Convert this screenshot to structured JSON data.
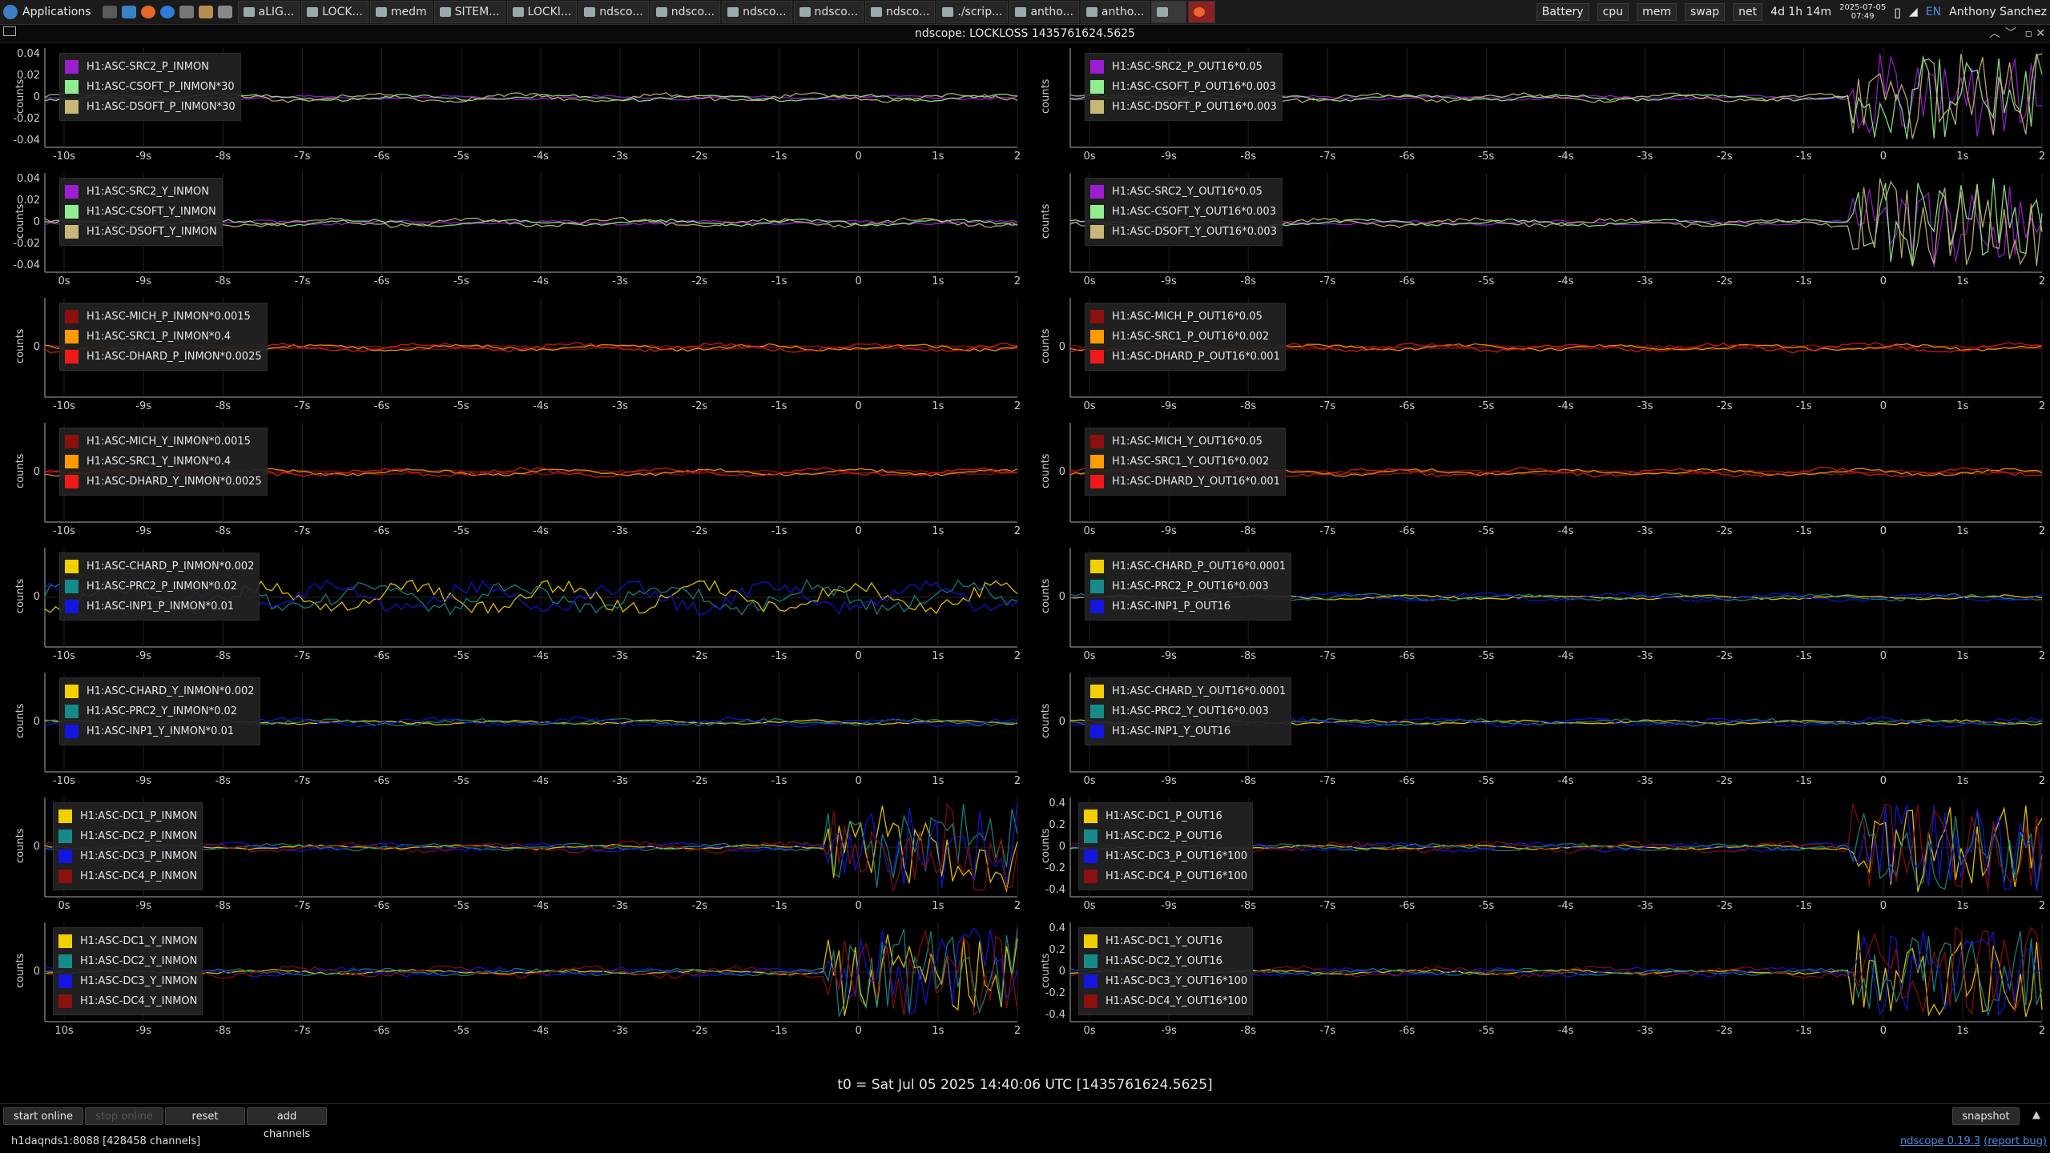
{
  "taskbar": {
    "applications_label": "Applications",
    "tasks": [
      {
        "label": "aLIG...",
        "active": false
      },
      {
        "label": "LOCK...",
        "active": false
      },
      {
        "label": "medm",
        "active": false
      },
      {
        "label": "SITEM...",
        "active": false
      },
      {
        "label": "LOCKI...",
        "active": false
      },
      {
        "label": "ndsco...",
        "active": false
      },
      {
        "label": "ndsco...",
        "active": false
      },
      {
        "label": "ndsco...",
        "active": false
      },
      {
        "label": "ndsco...",
        "active": false
      },
      {
        "label": "ndsco...",
        "active": false
      },
      {
        "label": "./scrip...",
        "active": false
      },
      {
        "label": "antho...",
        "active": false
      },
      {
        "label": "antho...",
        "active": false
      }
    ],
    "monitors": [
      "Battery",
      "cpu",
      "mem",
      "swap",
      "net"
    ],
    "uptime": "4d 1h 14m",
    "date": "2025-07-05",
    "time": "07:49",
    "lang": "EN",
    "user": "Anthony Sanchez"
  },
  "window": {
    "title": "ndscope: LOCKLOSS 1435761624.5625"
  },
  "y_axis_label": "counts",
  "panels": [
    {
      "legend": [
        {
          "label": "H1:ASC-SRC2_P_INMON",
          "color": "#9b1fd0"
        },
        {
          "label": "H1:ASC-CSOFT_P_INMON*30",
          "color": "#90ee90"
        },
        {
          "label": "H1:ASC-DSOFT_P_INMON*30",
          "color": "#c8b878"
        }
      ],
      "yticks": [
        "0.04",
        "0.02",
        "0",
        "-0.02",
        "-0.04"
      ],
      "xticks": [
        "-10s",
        "-9s",
        "-8s",
        "-7s",
        "-6s",
        "-5s",
        "-4s",
        "-3s",
        "-2s",
        "-1s",
        "0",
        "1s",
        "2"
      ]
    },
    {
      "legend": [
        {
          "label": "H1:ASC-SRC2_P_OUT16*0.05",
          "color": "#9b1fd0"
        },
        {
          "label": "H1:ASC-CSOFT_P_OUT16*0.003",
          "color": "#90ee90"
        },
        {
          "label": "H1:ASC-DSOFT_P_OUT16*0.003",
          "color": "#c8b878"
        }
      ],
      "yticks": [],
      "xticks": [
        "0s",
        "-9s",
        "-8s",
        "-7s",
        "-6s",
        "-5s",
        "-4s",
        "-3s",
        "-2s",
        "-1s",
        "0",
        "1s",
        "2"
      ]
    },
    {
      "legend": [
        {
          "label": "H1:ASC-SRC2_Y_INMON",
          "color": "#9b1fd0"
        },
        {
          "label": "H1:ASC-CSOFT_Y_INMON",
          "color": "#90ee90"
        },
        {
          "label": "H1:ASC-DSOFT_Y_INMON",
          "color": "#c8b878"
        }
      ],
      "yticks": [
        "0.04",
        "0.02",
        "0",
        "-0.02",
        "-0.04"
      ],
      "xticks": [
        "0s",
        "-9s",
        "-8s",
        "-7s",
        "-6s",
        "-5s",
        "-4s",
        "-3s",
        "-2s",
        "-1s",
        "0",
        "1s",
        "2"
      ]
    },
    {
      "legend": [
        {
          "label": "H1:ASC-SRC2_Y_OUT16*0.05",
          "color": "#9b1fd0"
        },
        {
          "label": "H1:ASC-CSOFT_Y_OUT16*0.003",
          "color": "#90ee90"
        },
        {
          "label": "H1:ASC-DSOFT_Y_OUT16*0.003",
          "color": "#c8b878"
        }
      ],
      "yticks": [],
      "xticks": [
        "0s",
        "-9s",
        "-8s",
        "-7s",
        "-6s",
        "-5s",
        "-4s",
        "-3s",
        "-2s",
        "-1s",
        "0",
        "1s",
        "2"
      ]
    },
    {
      "legend": [
        {
          "label": "H1:ASC-MICH_P_INMON*0.0015",
          "color": "#8b1010"
        },
        {
          "label": "H1:ASC-SRC1_P_INMON*0.4",
          "color": "#ff9a00"
        },
        {
          "label": "H1:ASC-DHARD_P_INMON*0.0025",
          "color": "#ee1a1a"
        }
      ],
      "yticks": [
        "0"
      ],
      "xticks": [
        "-10s",
        "-9s",
        "-8s",
        "-7s",
        "-6s",
        "-5s",
        "-4s",
        "-3s",
        "-2s",
        "-1s",
        "0",
        "1s",
        "2"
      ]
    },
    {
      "legend": [
        {
          "label": "H1:ASC-MICH_P_OUT16*0.05",
          "color": "#8b1010"
        },
        {
          "label": "H1:ASC-SRC1_P_OUT16*0.002",
          "color": "#ff9a00"
        },
        {
          "label": "H1:ASC-DHARD_P_OUT16*0.001",
          "color": "#ee1a1a"
        }
      ],
      "yticks": [
        "0"
      ],
      "xticks": [
        "0s",
        "-9s",
        "-8s",
        "-7s",
        "-6s",
        "-5s",
        "-4s",
        "-3s",
        "-2s",
        "-1s",
        "0",
        "1s",
        "2"
      ]
    },
    {
      "legend": [
        {
          "label": "H1:ASC-MICH_Y_INMON*0.0015",
          "color": "#8b1010"
        },
        {
          "label": "H1:ASC-SRC1_Y_INMON*0.4",
          "color": "#ff9a00"
        },
        {
          "label": "H1:ASC-DHARD_Y_INMON*0.0025",
          "color": "#ee1a1a"
        }
      ],
      "yticks": [
        "0"
      ],
      "xticks": [
        "-10s",
        "-9s",
        "-8s",
        "-7s",
        "-6s",
        "-5s",
        "-4s",
        "-3s",
        "-2s",
        "-1s",
        "0",
        "1s",
        "2"
      ]
    },
    {
      "legend": [
        {
          "label": "H1:ASC-MICH_Y_OUT16*0.05",
          "color": "#8b1010"
        },
        {
          "label": "H1:ASC-SRC1_Y_OUT16*0.002",
          "color": "#ff9a00"
        },
        {
          "label": "H1:ASC-DHARD_Y_OUT16*0.001",
          "color": "#ee1a1a"
        }
      ],
      "yticks": [
        "0"
      ],
      "xticks": [
        "0s",
        "-9s",
        "-8s",
        "-7s",
        "-6s",
        "-5s",
        "-4s",
        "-3s",
        "-2s",
        "-1s",
        "0",
        "1s",
        "2"
      ]
    },
    {
      "legend": [
        {
          "label": "H1:ASC-CHARD_P_INMON*0.002",
          "color": "#f2d000"
        },
        {
          "label": "H1:ASC-PRC2_P_INMON*0.02",
          "color": "#178a8a"
        },
        {
          "label": "H1:ASC-INP1_P_INMON*0.01",
          "color": "#1515e0"
        }
      ],
      "yticks": [
        "0"
      ],
      "xticks": [
        "-10s",
        "-9s",
        "-8s",
        "-7s",
        "-6s",
        "-5s",
        "-4s",
        "-3s",
        "-2s",
        "-1s",
        "0",
        "1s",
        "2"
      ]
    },
    {
      "legend": [
        {
          "label": "H1:ASC-CHARD_P_OUT16*0.0001",
          "color": "#f2d000"
        },
        {
          "label": "H1:ASC-PRC2_P_OUT16*0.003",
          "color": "#178a8a"
        },
        {
          "label": "H1:ASC-INP1_P_OUT16",
          "color": "#1515e0"
        }
      ],
      "yticks": [
        "0"
      ],
      "xticks": [
        "0s",
        "-9s",
        "-8s",
        "-7s",
        "-6s",
        "-5s",
        "-4s",
        "-3s",
        "-2s",
        "-1s",
        "0",
        "1s",
        "2"
      ]
    },
    {
      "legend": [
        {
          "label": "H1:ASC-CHARD_Y_INMON*0.002",
          "color": "#f2d000"
        },
        {
          "label": "H1:ASC-PRC2_Y_INMON*0.02",
          "color": "#178a8a"
        },
        {
          "label": "H1:ASC-INP1_Y_INMON*0.01",
          "color": "#1515e0"
        }
      ],
      "yticks": [
        "0"
      ],
      "xticks": [
        "-10s",
        "-9s",
        "-8s",
        "-7s",
        "-6s",
        "-5s",
        "-4s",
        "-3s",
        "-2s",
        "-1s",
        "0",
        "1s",
        "2"
      ]
    },
    {
      "legend": [
        {
          "label": "H1:ASC-CHARD_Y_OUT16*0.0001",
          "color": "#f2d000"
        },
        {
          "label": "H1:ASC-PRC2_Y_OUT16*0.003",
          "color": "#178a8a"
        },
        {
          "label": "H1:ASC-INP1_Y_OUT16",
          "color": "#1515e0"
        }
      ],
      "yticks": [
        "0"
      ],
      "xticks": [
        "0s",
        "-9s",
        "-8s",
        "-7s",
        "-6s",
        "-5s",
        "-4s",
        "-3s",
        "-2s",
        "-1s",
        "0",
        "1s",
        "2"
      ]
    },
    {
      "legend": [
        {
          "label": "H1:ASC-DC1_P_INMON",
          "color": "#f2d000"
        },
        {
          "label": "H1:ASC-DC2_P_INMON",
          "color": "#178a8a"
        },
        {
          "label": "H1:ASC-DC3_P_INMON",
          "color": "#1515e0"
        },
        {
          "label": "H1:ASC-DC4_P_INMON",
          "color": "#8b1010"
        }
      ],
      "yticks": [
        "0"
      ],
      "xticks": [
        "0s",
        "-9s",
        "-8s",
        "-7s",
        "-6s",
        "-5s",
        "-4s",
        "-3s",
        "-2s",
        "-1s",
        "0",
        "1s",
        "2"
      ]
    },
    {
      "legend": [
        {
          "label": "H1:ASC-DC1_P_OUT16",
          "color": "#f2d000"
        },
        {
          "label": "H1:ASC-DC2_P_OUT16",
          "color": "#178a8a"
        },
        {
          "label": "H1:ASC-DC3_P_OUT16*100",
          "color": "#1515e0"
        },
        {
          "label": "H1:ASC-DC4_P_OUT16*100",
          "color": "#8b1010"
        }
      ],
      "yticks": [
        "0.4",
        "0.2",
        "0",
        "-0.2",
        "-0.4"
      ],
      "xticks": [
        "0s",
        "-9s",
        "-8s",
        "-7s",
        "-6s",
        "-5s",
        "-4s",
        "-3s",
        "-2s",
        "-1s",
        "0",
        "1s",
        "2"
      ]
    },
    {
      "legend": [
        {
          "label": "H1:ASC-DC1_Y_INMON",
          "color": "#f2d000"
        },
        {
          "label": "H1:ASC-DC2_Y_INMON",
          "color": "#178a8a"
        },
        {
          "label": "H1:ASC-DC3_Y_INMON",
          "color": "#1515e0"
        },
        {
          "label": "H1:ASC-DC4_Y_INMON",
          "color": "#8b1010"
        }
      ],
      "yticks": [
        "0"
      ],
      "xticks": [
        "10s",
        "-9s",
        "-8s",
        "-7s",
        "-6s",
        "-5s",
        "-4s",
        "-3s",
        "-2s",
        "-1s",
        "0",
        "1s",
        "2"
      ]
    },
    {
      "legend": [
        {
          "label": "H1:ASC-DC1_Y_OUT16",
          "color": "#f2d000"
        },
        {
          "label": "H1:ASC-DC2_Y_OUT16",
          "color": "#178a8a"
        },
        {
          "label": "H1:ASC-DC3_Y_OUT16*100",
          "color": "#1515e0"
        },
        {
          "label": "H1:ASC-DC4_Y_OUT16*100",
          "color": "#8b1010"
        }
      ],
      "yticks": [
        "0.4",
        "0.2",
        "0",
        "-0.2",
        "-0.4"
      ],
      "xticks": [
        "0s",
        "-9s",
        "-8s",
        "-7s",
        "-6s",
        "-5s",
        "-4s",
        "-3s",
        "-2s",
        "-1s",
        "0",
        "1s",
        "2"
      ]
    }
  ],
  "footer": {
    "t0_text": "t0 = Sat Jul 05 2025 14:40:06 UTC [1435761624.5625]",
    "buttons": {
      "start_online": "start online",
      "stop_online": "stop online",
      "reset": "reset",
      "add_channels": "add channels",
      "snapshot": "snapshot"
    },
    "status_left": "h1daqnds1:8088  [428458 channels]",
    "version": "ndscope 0.19.3",
    "report_bug": "(report bug)"
  }
}
